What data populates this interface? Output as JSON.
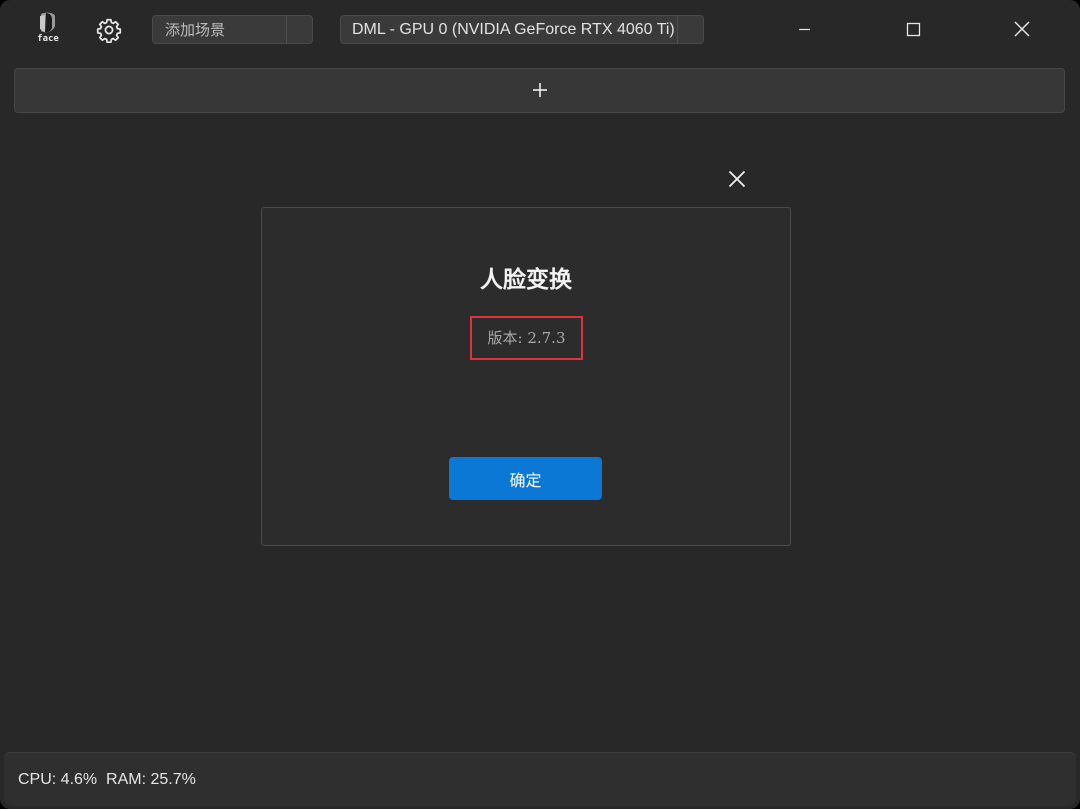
{
  "app": {
    "logo_text": "face",
    "icons": {
      "logo": "face-logo-icon",
      "settings": "gear-icon",
      "minimize": "minimize-icon",
      "maximize": "maximize-icon",
      "close": "close-icon",
      "add": "plus-icon",
      "dialog_close": "close-icon"
    }
  },
  "toolbar": {
    "scene_combo_value": "添加场景",
    "device_combo_value": "DML - GPU 0 (NVIDIA GeForce RTX 4060 Ti)"
  },
  "dialog": {
    "title": "人脸变换",
    "version": "版本: 2.7.3",
    "ok_label": "确定"
  },
  "status": {
    "text": "CPU: 4.6%  RAM: 25.7%"
  },
  "colors": {
    "background": "#282828",
    "accent": "#0a78d4",
    "highlight_box": "#e0323a"
  }
}
